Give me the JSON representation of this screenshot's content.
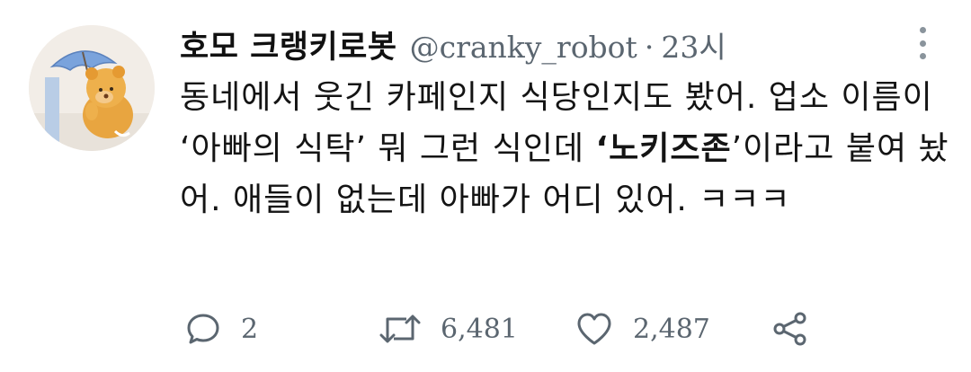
{
  "tweet": {
    "display_name": "호모 크랭키로봇",
    "handle": "@cranky_robot",
    "separator": "·",
    "time": "23시",
    "text_part1": "동네에서 웃긴 카페인지 식당인지도 봤어. 업소 이름이 ‘아빠의 식탁’ 뭐 그런 식인데 ",
    "text_bold": "‘노키즈존",
    "text_part2": "’이라고 붙여 놨어. 애들이 없는데 아빠가 어디 있어. ㅋㅋㅋ",
    "replies": "2",
    "retweets": "6,481",
    "likes": "2,487"
  },
  "icons": {
    "more": "more-vertical-icon",
    "reply": "speech-bubble-icon",
    "retweet": "retweet-arrows-icon",
    "like": "heart-outline-icon",
    "share": "share-nodes-icon"
  },
  "colors": {
    "text": "#141414",
    "muted": "#5b6670",
    "background": "#ffffff"
  }
}
